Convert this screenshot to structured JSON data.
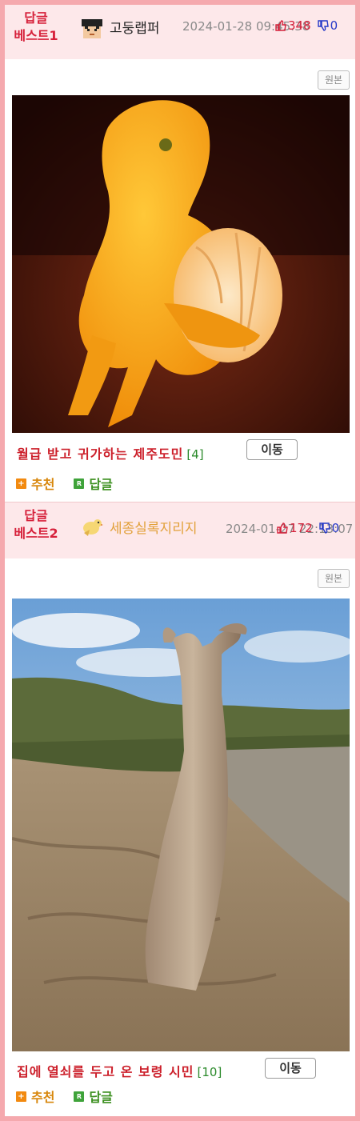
{
  "posts": [
    {
      "rank_label_1": "답글",
      "rank_label_2": "베스트1",
      "author": "고둥랩퍼",
      "date": "2024-01-28 09:45:38",
      "upvotes": "348",
      "downvotes": "0",
      "original_label": "원본",
      "title": "월급 받고 귀가하는 제주도민",
      "comment_count": "[4]",
      "move_label": "이동",
      "recommend_label": "추천",
      "reply_label": "답글",
      "reply_icon": "R"
    },
    {
      "rank_label_1": "답글",
      "rank_label_2": "베스트2",
      "author": "세종실록지리지",
      "date": "2024-01-27 22:13:07",
      "upvotes": "172",
      "downvotes": "0",
      "original_label": "원본",
      "title": "집에 열쇠를 두고 온 보령 시민",
      "comment_count": "[10]",
      "move_label": "이동",
      "recommend_label": "추천",
      "reply_label": "답글",
      "reply_icon": "R"
    }
  ],
  "icons": {
    "upvote": "thumbs-up-icon",
    "downvote": "thumbs-down-icon",
    "recommend": "plus-icon",
    "reply": "reply-icon"
  },
  "colors": {
    "frame": "#f5a9ae",
    "header_bg": "#fde8ea",
    "rank": "#d6213b",
    "title": "#cc1f2a",
    "comment_count": "#2b8a2b",
    "recommend": "#d8870d",
    "reply": "#3b8f1f"
  }
}
